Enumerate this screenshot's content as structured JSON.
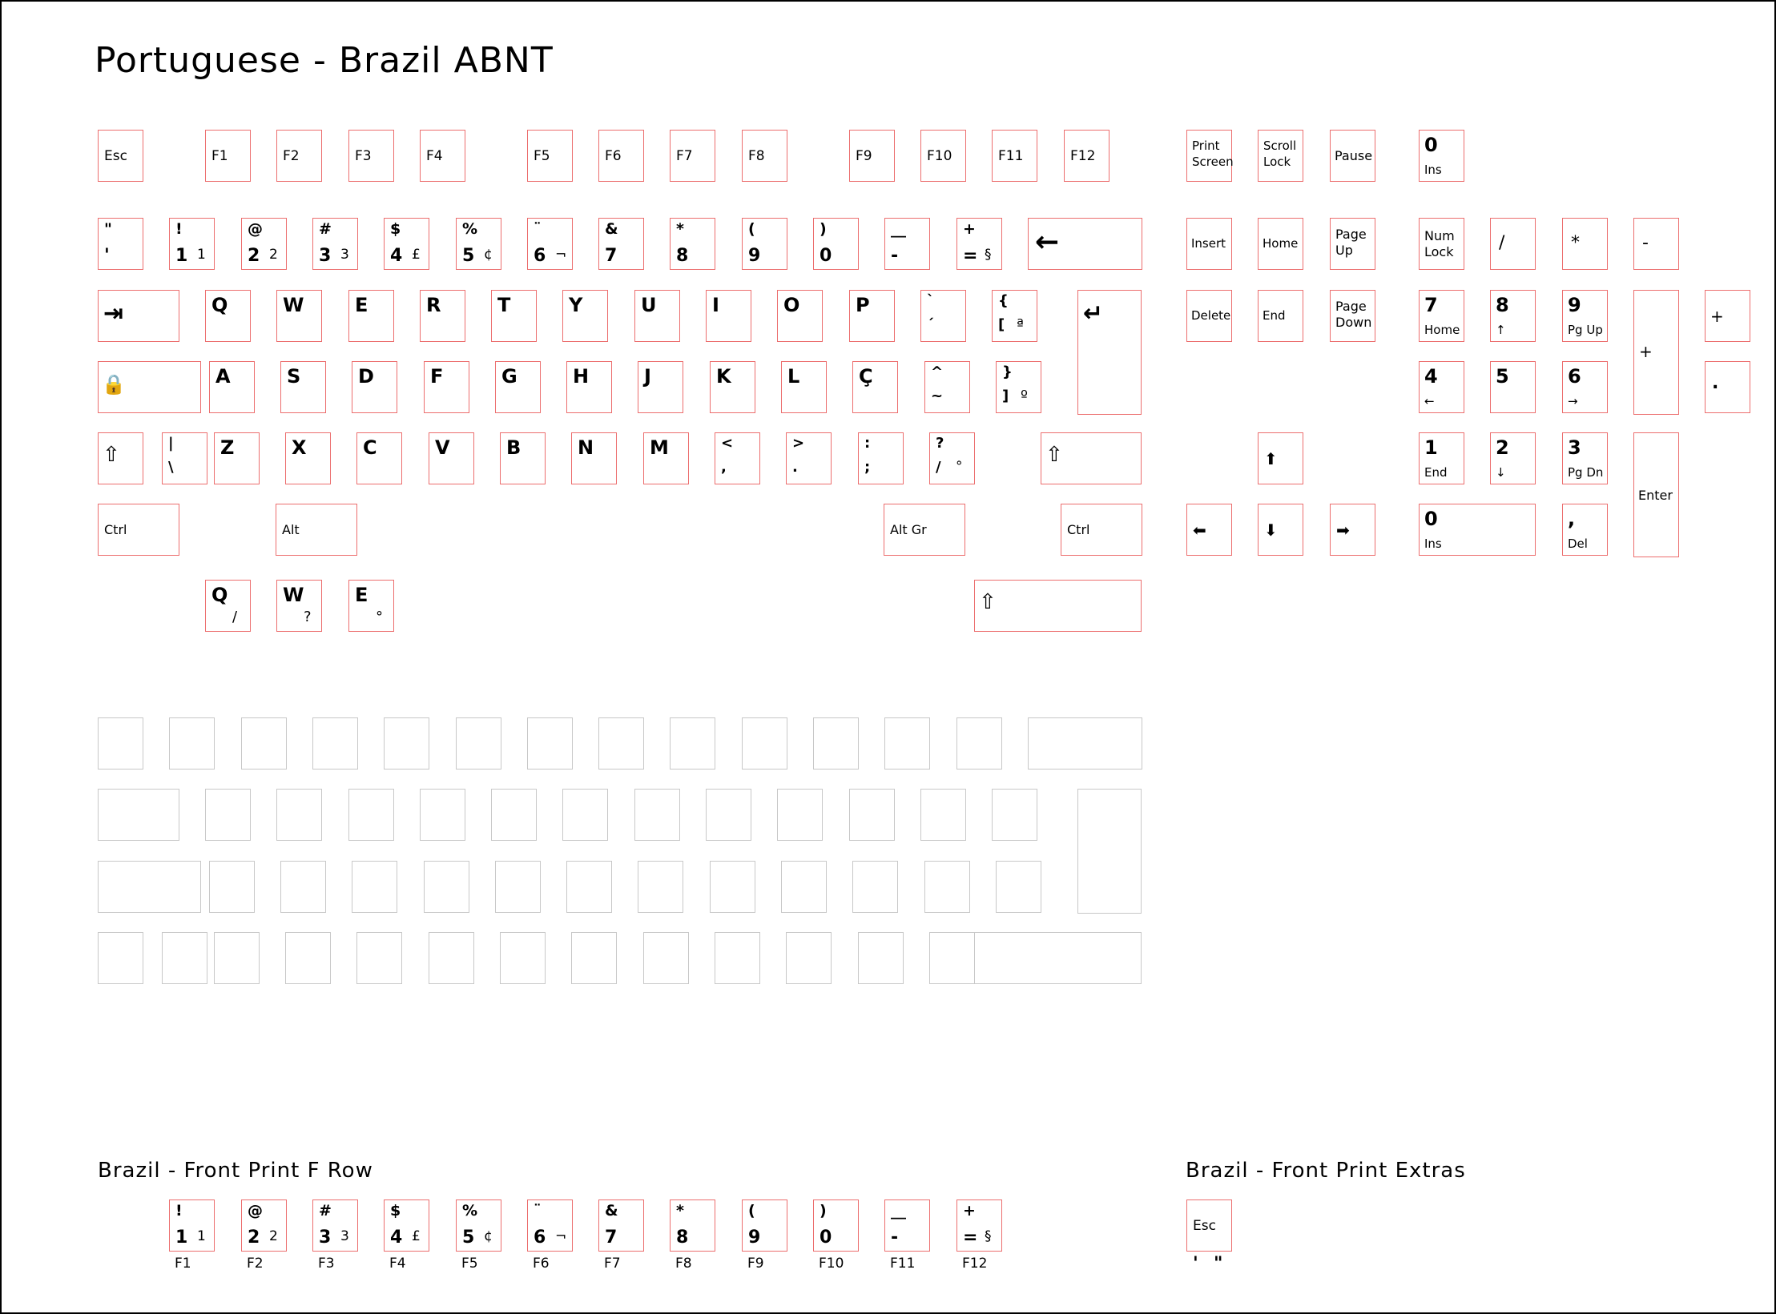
{
  "title": "Portuguese - Brazil ABNT",
  "icons": {
    "backspace": "←",
    "tab": "⇥",
    "enter": "↵",
    "capslock": "🔒",
    "shift": "⇧",
    "arrow_up": "⬆",
    "arrow_down": "⬇",
    "arrow_left": "⬅",
    "arrow_right": "➡",
    "small_up": "↑",
    "small_down": "↓",
    "small_left": "←",
    "small_right": "→"
  },
  "keyboard": {
    "function_row": [
      "Esc",
      "F1",
      "F2",
      "F3",
      "F4",
      "F5",
      "F6",
      "F7",
      "F8",
      "F9",
      "F10",
      "F11",
      "F12"
    ],
    "number_row": [
      {
        "shift": "\"",
        "base": "'",
        "alt": ""
      },
      {
        "shift": "!",
        "base": "1",
        "alt": "1"
      },
      {
        "shift": "@",
        "base": "2",
        "alt": "2"
      },
      {
        "shift": "#",
        "base": "3",
        "alt": "3"
      },
      {
        "shift": "$",
        "base": "4",
        "alt": "£"
      },
      {
        "shift": "%",
        "base": "5",
        "alt": "¢"
      },
      {
        "shift": "¨",
        "base": "6",
        "alt": "¬"
      },
      {
        "shift": "&",
        "base": "7",
        "alt": ""
      },
      {
        "shift": "*",
        "base": "8",
        "alt": ""
      },
      {
        "shift": "(",
        "base": "9",
        "alt": ""
      },
      {
        "shift": ")",
        "base": "0",
        "alt": ""
      },
      {
        "shift": "__",
        "base": "-",
        "alt": ""
      },
      {
        "shift": "+",
        "base": "=",
        "alt": "§"
      }
    ],
    "top_row": [
      "Q",
      "W",
      "E",
      "R",
      "T",
      "Y",
      "U",
      "I",
      "O",
      "P"
    ],
    "top_row_extra": [
      {
        "shift": "`",
        "base": "´",
        "alt": ""
      },
      {
        "shift": "{",
        "base": "[",
        "alt": "ª"
      }
    ],
    "home_row": [
      "A",
      "S",
      "D",
      "F",
      "G",
      "H",
      "J",
      "K",
      "L",
      "Ç"
    ],
    "home_row_extra": [
      {
        "shift": "^",
        "base": "~",
        "alt": ""
      },
      {
        "shift": "}",
        "base": "]",
        "alt": "º"
      }
    ],
    "bottom_row_iso": {
      "shift": "|",
      "base": "\\"
    },
    "bottom_row": [
      "Z",
      "X",
      "C",
      "V",
      "B",
      "N",
      "M"
    ],
    "bottom_row_extra": [
      {
        "shift": "<",
        "base": ","
      },
      {
        "shift": ">",
        "base": "."
      },
      {
        "shift": ":",
        "base": ";"
      },
      {
        "shift": "?",
        "base": "/",
        "alt": "°"
      }
    ],
    "modifiers": {
      "ctrl_left": "Ctrl",
      "alt": "Alt",
      "altgr": "Alt Gr",
      "ctrl_right": "Ctrl"
    },
    "altgr_extras": [
      {
        "letter": "Q",
        "alt": "/"
      },
      {
        "letter": "W",
        "alt": "?"
      },
      {
        "letter": "E",
        "alt": "°"
      }
    ]
  },
  "nav": {
    "print_screen": [
      "Print",
      "Screen"
    ],
    "scroll_lock": [
      "Scroll",
      "Lock"
    ],
    "pause": "Pause",
    "insert": "Insert",
    "home": "Home",
    "page_up": [
      "Page",
      "Up"
    ],
    "delete": "Delete",
    "end": "End",
    "page_down": [
      "Page",
      "Down"
    ]
  },
  "numpad": {
    "top_zero": {
      "main": "0",
      "sub": "Ins"
    },
    "num_lock": [
      "Num",
      "Lock"
    ],
    "divide": "/",
    "multiply": "*",
    "minus": "-",
    "plus": "+",
    "dot": ".",
    "enter": "Enter",
    "row7": [
      {
        "main": "7",
        "sub": "Home"
      },
      {
        "main": "8",
        "sub": "↑"
      },
      {
        "main": "9",
        "sub": "Pg Up"
      }
    ],
    "row4": [
      {
        "main": "4",
        "sub": "←"
      },
      {
        "main": "5",
        "sub": ""
      },
      {
        "main": "6",
        "sub": "→"
      }
    ],
    "row1": [
      {
        "main": "1",
        "sub": "End"
      },
      {
        "main": "2",
        "sub": "↓"
      },
      {
        "main": "3",
        "sub": "Pg Dn"
      }
    ],
    "zero": {
      "main": "0",
      "sub": "Ins"
    },
    "comma": {
      "main": ",",
      "sub": "Del"
    }
  },
  "front_f_row": {
    "title": "Brazil - Front Print F Row",
    "f_labels": [
      "F1",
      "F2",
      "F3",
      "F4",
      "F5",
      "F6",
      "F7",
      "F8",
      "F9",
      "F10",
      "F11",
      "F12"
    ]
  },
  "front_extras": {
    "title": "Brazil - Front Print Extras",
    "key": "Esc",
    "below_single": "'",
    "below_double": "\""
  }
}
